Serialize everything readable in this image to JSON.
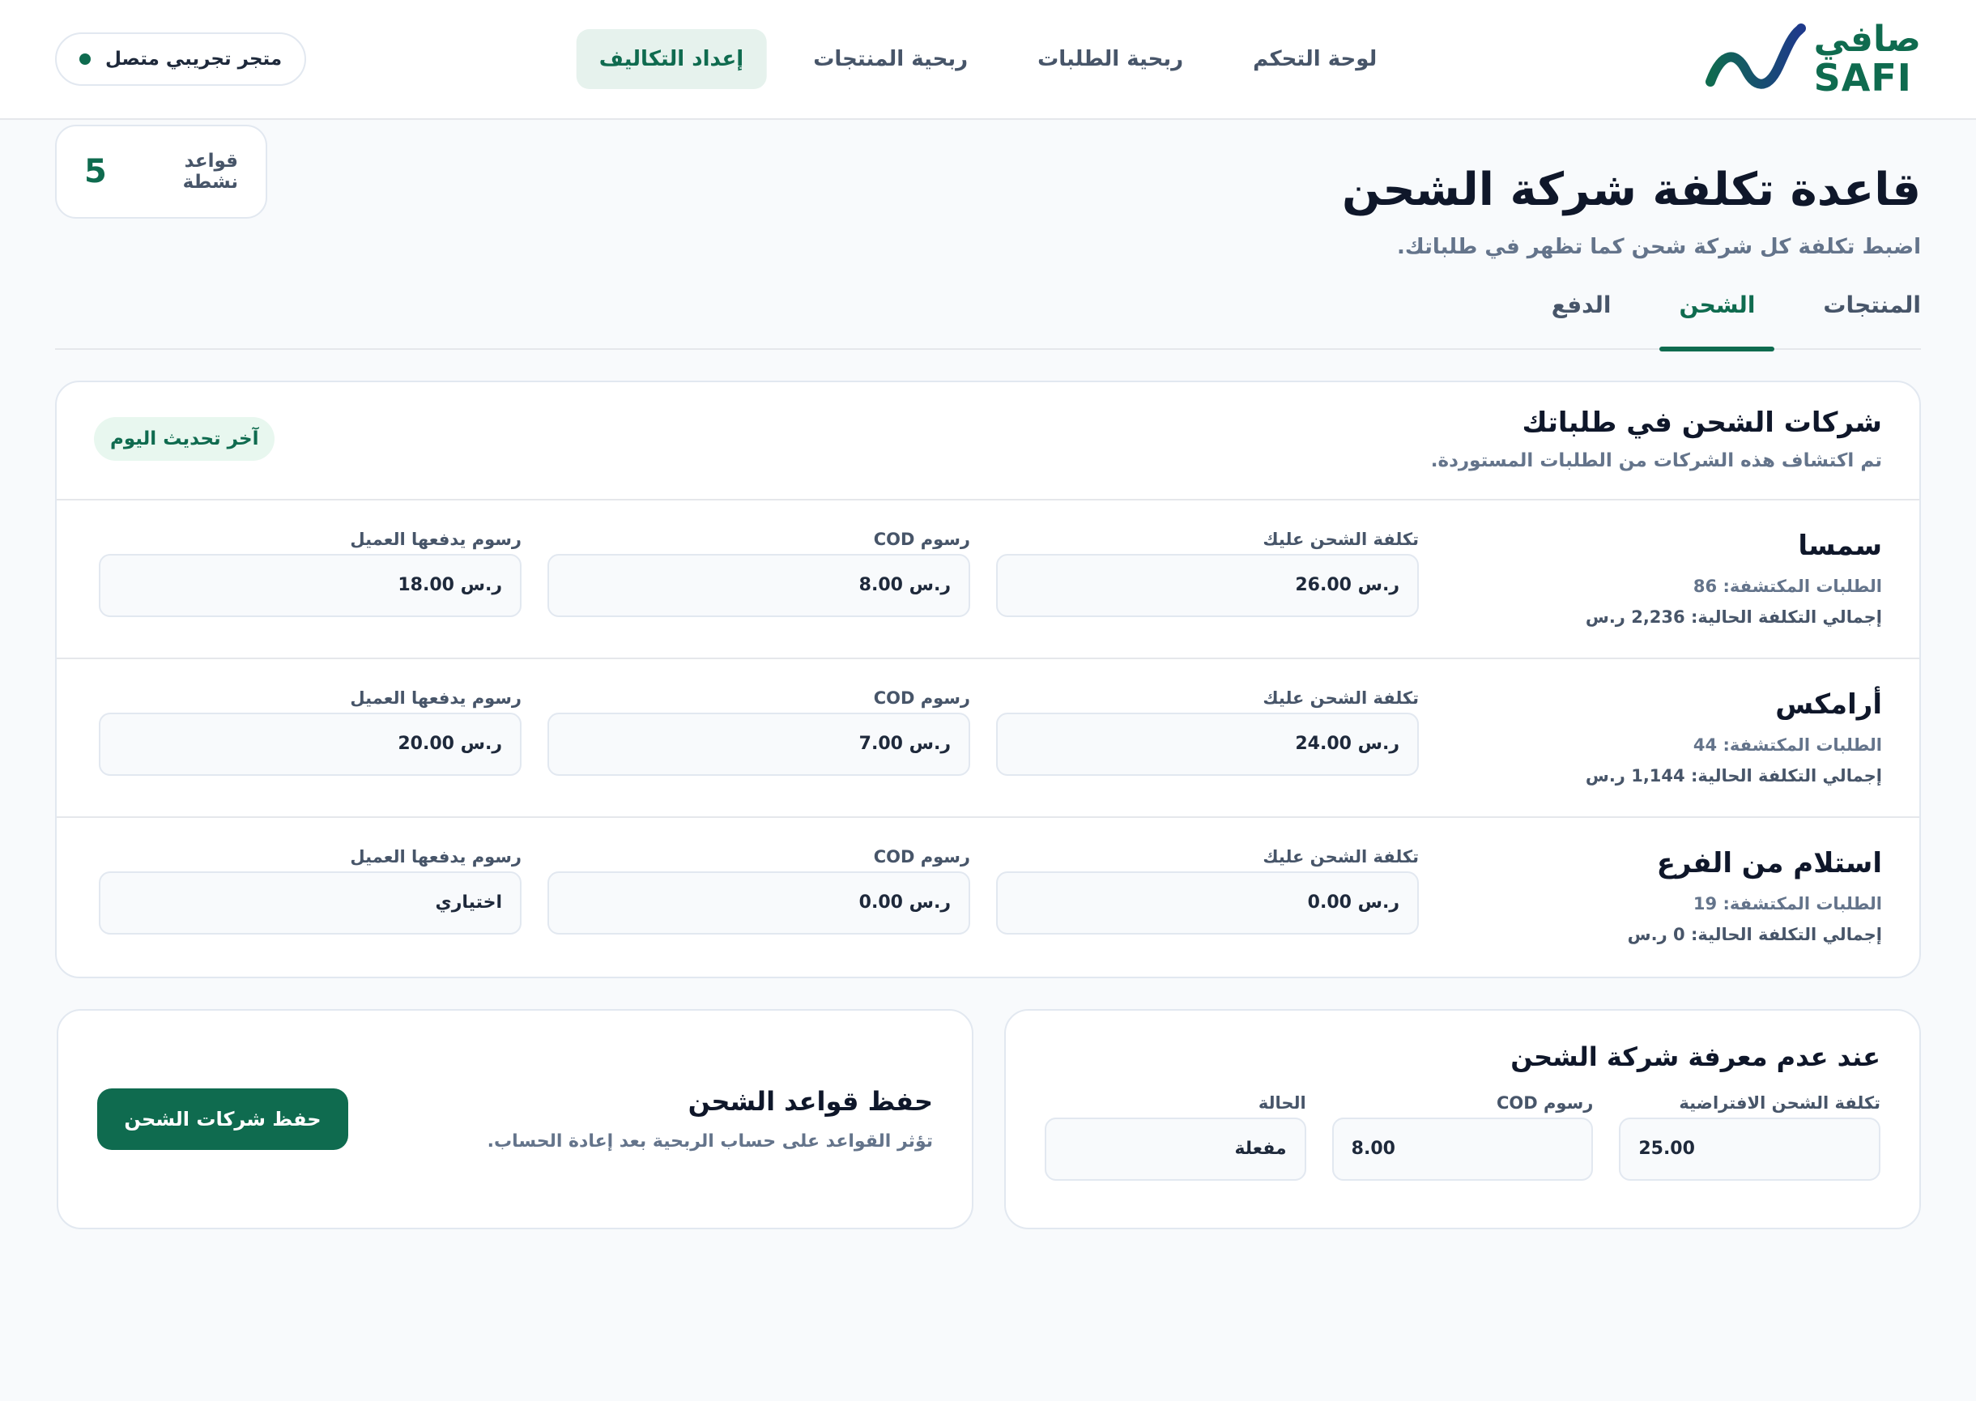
{
  "brand": {
    "name_ar": "صافي",
    "name_en": "SAFI"
  },
  "nav": {
    "items": [
      {
        "label": "لوحة التحكم"
      },
      {
        "label": "ربحية الطلبات"
      },
      {
        "label": "ربحية المنتجات"
      },
      {
        "label": "إعداد التكاليف"
      }
    ],
    "active": "إعداد التكاليف"
  },
  "store": {
    "label": "متجر تجريبي متصل"
  },
  "page": {
    "title": "قاعدة تكلفة شركة الشحن",
    "subtitle": "اضبط تكلفة كل شركة شحن كما تظهر في طلباتك."
  },
  "rules": {
    "label": "قواعد نشطة",
    "value": "5"
  },
  "tabs": [
    {
      "label": "المنتجات"
    },
    {
      "label": "الشحن"
    },
    {
      "label": "الدفع"
    }
  ],
  "carriers": {
    "title": "شركات الشحن في طلباتك",
    "subtitle": "تم اكتشاف هذه الشركات من الطلبات المستوردة.",
    "badge": "آخر تحديث اليوم",
    "field_labels": {
      "cost": "تكلفة الشحن عليك",
      "cod": "رسوم COD",
      "customer_fee": "رسوم يدفعها العميل"
    },
    "rows": [
      {
        "name": "سمسا",
        "detected": "الطلبات المكتشفة: 86",
        "total": "إجمالي التكلفة الحالية: 2,236 ر.س",
        "cost": "ر.س 26.00",
        "cod": "ر.س 8.00",
        "customer_fee": "ر.س 18.00"
      },
      {
        "name": "أرامكس",
        "detected": "الطلبات المكتشفة: 44",
        "total": "إجمالي التكلفة الحالية: 1,144 ر.س",
        "cost": "ر.س 24.00",
        "cod": "ر.س 7.00",
        "customer_fee": "ر.س 20.00"
      },
      {
        "name": "استلام من الفرع",
        "detected": "الطلبات المكتشفة: 19",
        "total": "إجمالي التكلفة الحالية: 0 ر.س",
        "cost": "ر.س 0.00",
        "cod": "ر.س 0.00",
        "customer_fee": "اختياري"
      }
    ]
  },
  "fallback": {
    "title": "عند عدم معرفة شركة الشحن",
    "default_cost_label": "تكلفة الشحن الافتراضية",
    "default_cost_value": "25.00",
    "cod_label": "رسوم COD",
    "cod_value": "8.00",
    "status_label": "الحالة",
    "status_value": "مفعلة"
  },
  "save": {
    "title": "حفظ قواعد الشحن",
    "subtitle": "تؤثر القواعد على حساب الربحية بعد إعادة الحساب.",
    "button": "حفظ شركات الشحن"
  },
  "colors": {
    "accent": "#0f6b4f",
    "accent_light": "#e6f2ed",
    "logo_gradient_end": "#1e3a8a"
  }
}
